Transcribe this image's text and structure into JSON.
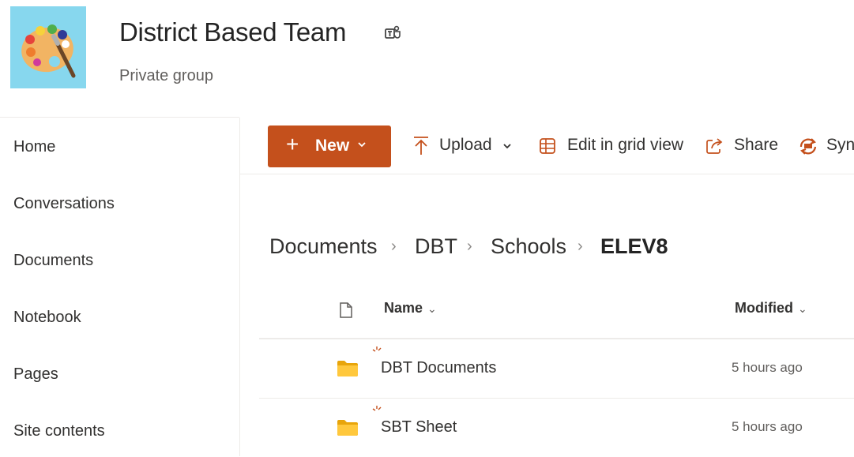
{
  "header": {
    "title": "District Based Team",
    "subtitle": "Private group",
    "logo_icon": "palette-icon",
    "teams_icon": "teams-icon"
  },
  "nav": {
    "items": [
      {
        "label": "Home"
      },
      {
        "label": "Conversations"
      },
      {
        "label": "Documents"
      },
      {
        "label": "Notebook"
      },
      {
        "label": "Pages"
      },
      {
        "label": "Site contents"
      }
    ]
  },
  "commandbar": {
    "new_label": "New",
    "upload_label": "Upload",
    "edit_grid_label": "Edit in grid view",
    "share_label": "Share",
    "sync_label": "Syn",
    "accent_color": "#c4501c"
  },
  "breadcrumb": [
    "Documents",
    "DBT",
    "Schools",
    "ELEV8"
  ],
  "table": {
    "columns": {
      "name": "Name",
      "modified": "Modified"
    },
    "rows": [
      {
        "name": "DBT Documents",
        "modified": "5 hours ago",
        "type": "folder"
      },
      {
        "name": "SBT Sheet",
        "modified": "5 hours ago",
        "type": "folder"
      }
    ]
  }
}
